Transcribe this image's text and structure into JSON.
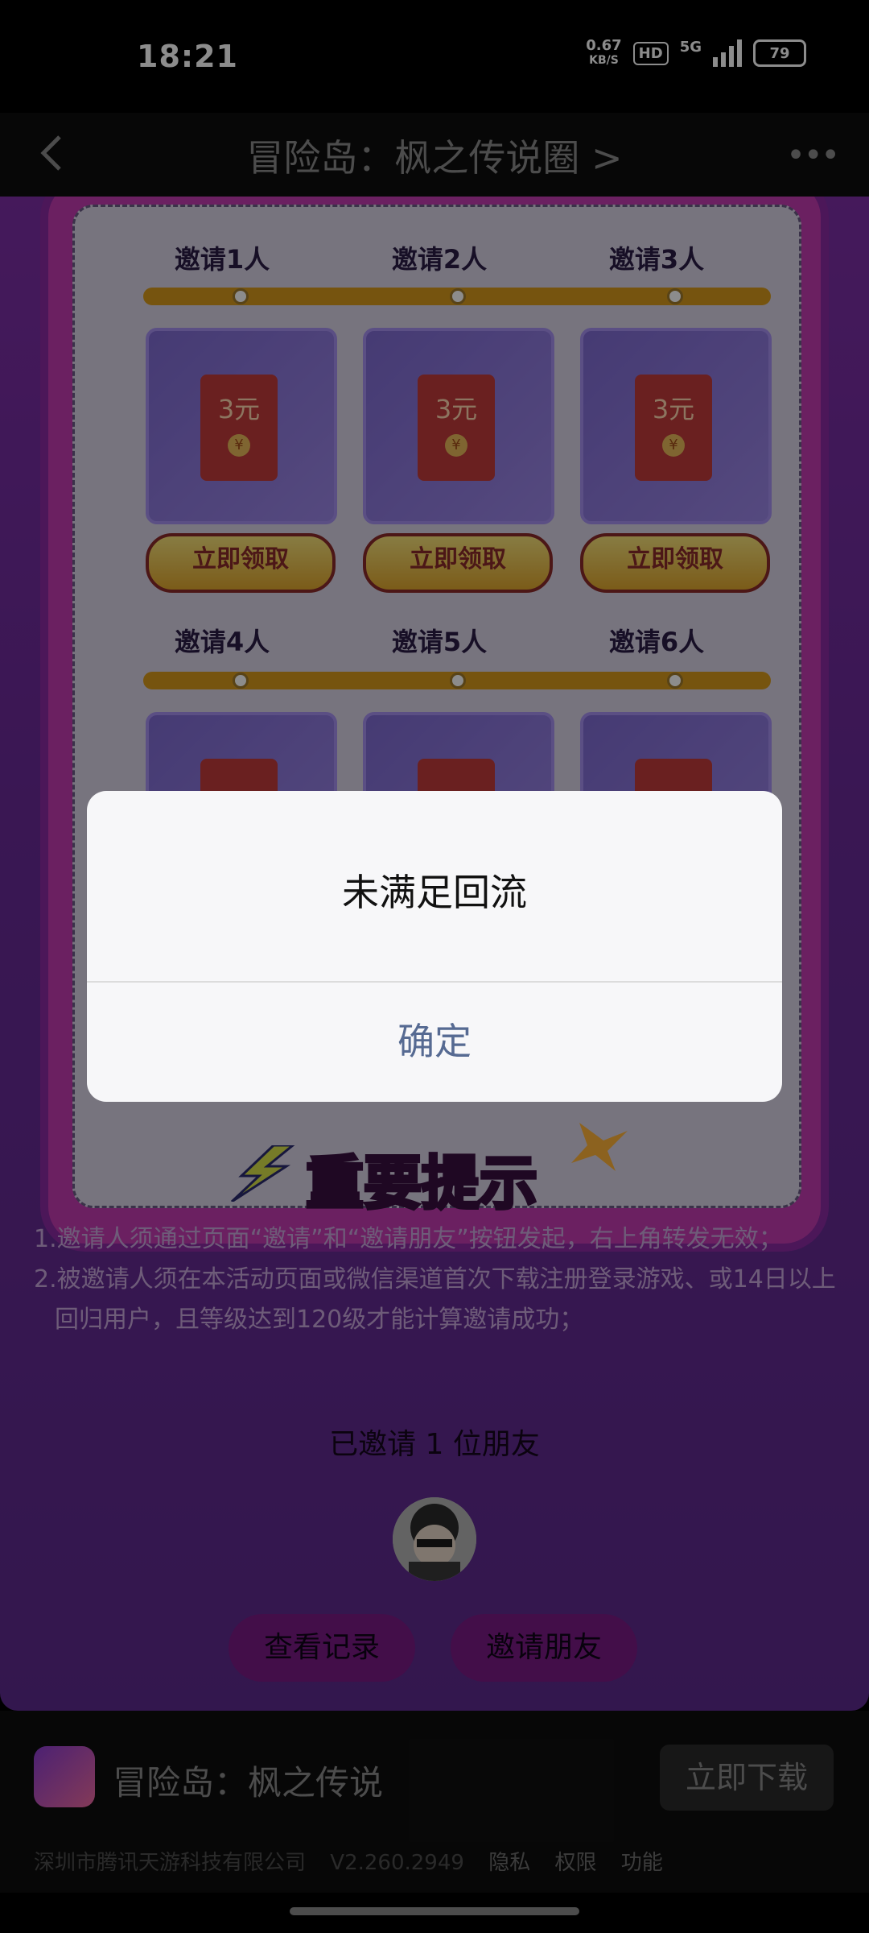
{
  "status_bar": {
    "time": "18:21",
    "speed_value": "0.67",
    "speed_unit": "KB/S",
    "hd": "HD",
    "network": "5G",
    "battery": "79"
  },
  "nav": {
    "title": "冒险岛：枫之传说圈 >"
  },
  "rewards": {
    "row1_labels": [
      "邀请1人",
      "邀请2人",
      "邀请3人"
    ],
    "row2_labels": [
      "邀请4人",
      "邀请5人",
      "邀请6人"
    ],
    "amount": "3元",
    "coin": "¥",
    "claim_label": "立即领取"
  },
  "tips": {
    "title": "重要提示",
    "line1": "1.邀请人须通过页面“邀请”和“邀请朋友”按钮发起，右上角转发无效；",
    "line2": "2.被邀请人须在本活动页面或微信渠道首次下载注册登录游戏、或14日以上",
    "line3": "回归用户，且等级达到120级才能计算邀请成功；"
  },
  "invite_status": "已邀请 1 位朋友",
  "buttons": {
    "records": "查看记录",
    "invite": "邀请朋友"
  },
  "app_bar": {
    "app_name": "冒险岛：枫之传说",
    "download": "立即下载",
    "company": "深圳市腾讯天游科技有限公司",
    "version": "V2.260.2949",
    "privacy": "隐私",
    "permissions": "权限",
    "features": "功能"
  },
  "dialog": {
    "message": "未满足回流",
    "confirm": "确定"
  }
}
